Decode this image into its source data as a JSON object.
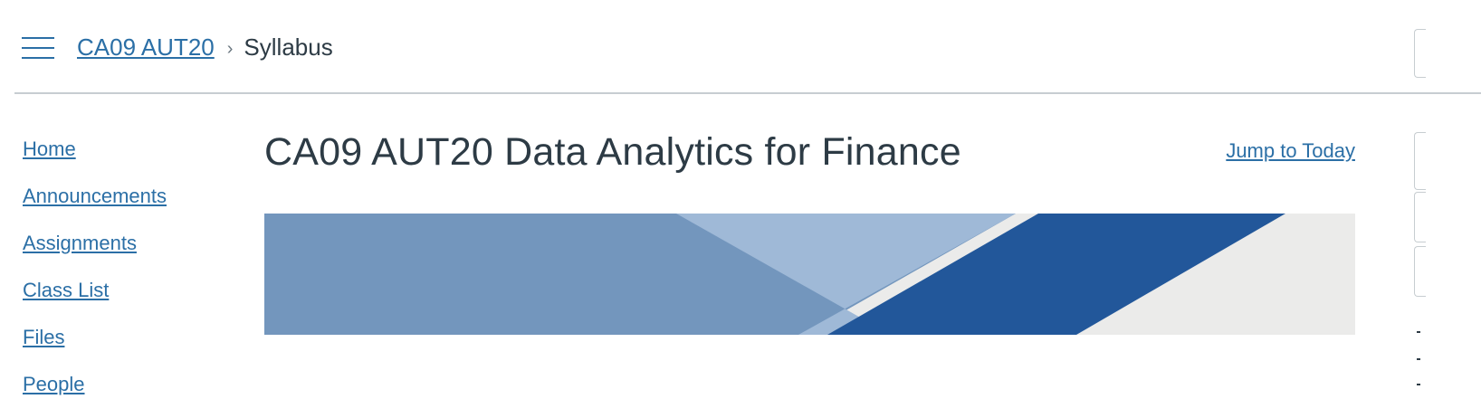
{
  "header": {
    "breadcrumb": {
      "course": "CA09 AUT20",
      "separator": "›",
      "current": "Syllabus"
    }
  },
  "course_nav": {
    "items": [
      {
        "label": "Home"
      },
      {
        "label": "Announcements"
      },
      {
        "label": "Assignments"
      },
      {
        "label": "Class List"
      },
      {
        "label": "Files"
      },
      {
        "label": "People"
      }
    ]
  },
  "main": {
    "title": "CA09 AUT20 Data Analytics for Finance",
    "jump_to_today": "Jump to Today"
  },
  "colors": {
    "link": "#2b6fa6",
    "banner_dark_blue": "#22579a",
    "banner_mid_blue": "#7396bd",
    "banner_light_blue": "#9fb9d7",
    "banner_grey": "#ebebea"
  }
}
